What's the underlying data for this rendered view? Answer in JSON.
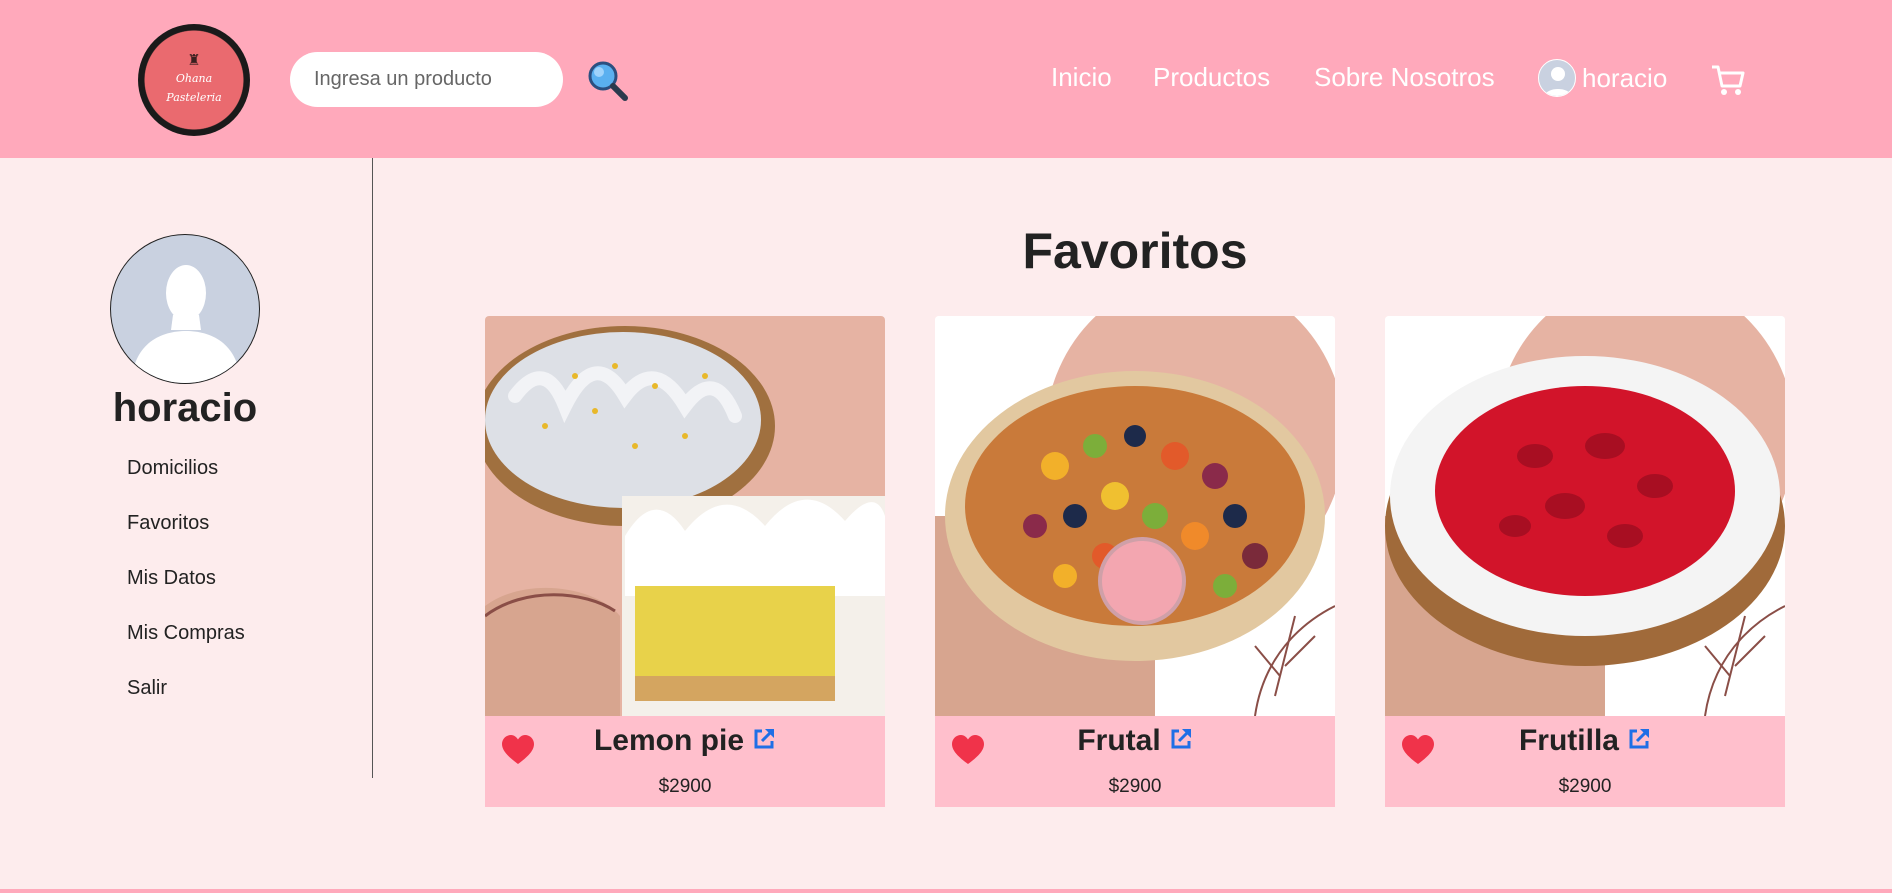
{
  "header": {
    "logo_text_line1": "Ohana",
    "logo_text_line2": "Pasteleria",
    "search_placeholder": "Ingresa un producto",
    "nav": {
      "inicio": "Inicio",
      "productos": "Productos",
      "sobre": "Sobre Nosotros"
    },
    "user_name": "horacio",
    "icons": [
      "search-icon",
      "user-avatar-icon",
      "cart-icon"
    ]
  },
  "sidebar": {
    "user_name": "horacio",
    "items": [
      {
        "label": "Domicilios"
      },
      {
        "label": "Favoritos"
      },
      {
        "label": "Mis Datos"
      },
      {
        "label": "Mis Compras"
      },
      {
        "label": "Salir"
      }
    ]
  },
  "main": {
    "title": "Favoritos",
    "products": [
      {
        "name": "Lemon pie",
        "price": "$2900",
        "image": "lemon-pie-photo"
      },
      {
        "name": "Frutal",
        "price": "$2900",
        "image": "fruit-tart-photo"
      },
      {
        "name": "Frutilla",
        "price": "$2900",
        "image": "strawberry-tart-photo"
      }
    ]
  },
  "colors": {
    "header_bg": "#ffa9bb",
    "page_bg": "#fdeced",
    "card_footer_bg": "#ffbfcc",
    "heart": "#f0334a",
    "link_icon": "#1f6fe6"
  }
}
